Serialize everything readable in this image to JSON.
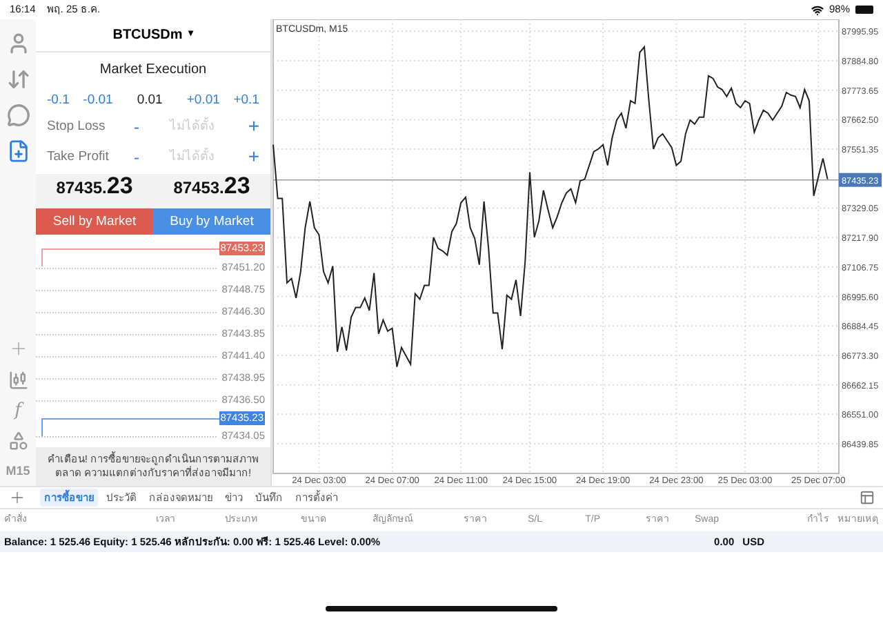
{
  "status_bar": {
    "time": "16:14",
    "date": "พฤ. 25 ธ.ค.",
    "battery": "98%"
  },
  "toolbar": {
    "tools": [
      {
        "selected": false
      },
      {
        "selected": false
      },
      {
        "selected": false
      },
      {
        "selected": true
      }
    ],
    "indicator_glyph": "f",
    "timeframe": "M15"
  },
  "order_panel": {
    "symbol": "BTCUSDm",
    "symbol_caret": "▾",
    "execution": "Market Execution",
    "volume_steps": [
      {
        "label": "-0.1"
      },
      {
        "label": "-0.01"
      },
      {
        "label": "+0.01"
      },
      {
        "label": "+0.1"
      }
    ],
    "volume": "0.01",
    "fields": [
      {
        "label": "Stop Loss",
        "placeholder": "ไม่ได้ตั้ง",
        "minus": "-",
        "plus": "+"
      },
      {
        "label": "Take Profit",
        "placeholder": "ไม่ได้ตั้ง",
        "minus": "-",
        "plus": "+"
      }
    ],
    "bid": {
      "head": "87435.",
      "tail": "23"
    },
    "ask": {
      "head": "87453.",
      "tail": "23"
    },
    "sell_button": "Sell by Market",
    "buy_button": "Buy by Market",
    "depth": [
      {
        "kind": "ask",
        "price": "87453.23"
      },
      {
        "kind": "level",
        "price": "87451.20"
      },
      {
        "kind": "level",
        "price": "87448.75"
      },
      {
        "kind": "level",
        "price": "87446.30"
      },
      {
        "kind": "level",
        "price": "87443.85"
      },
      {
        "kind": "level",
        "price": "87441.40"
      },
      {
        "kind": "level",
        "price": "87438.95"
      },
      {
        "kind": "level",
        "price": "87436.50"
      },
      {
        "kind": "bid",
        "price": "87435.23"
      },
      {
        "kind": "level",
        "price": "87434.05"
      }
    ],
    "warning": "คำเตือน! การซื้อขายจะถูกดำเนินการตามสภาพตลาด ความแตกต่างกับราคาที่ส่งอาจมีมาก!"
  },
  "chart": {
    "title": "BTCUSDm, M15",
    "chart_data": {
      "type": "line",
      "grid": true,
      "ylim": [
        86328,
        88041
      ],
      "ref_lines": [
        {
          "axis": "y",
          "value": 87435.23,
          "label": "87435.23"
        }
      ],
      "yticks": [
        {
          "value": 87995.95,
          "label": "87995.95"
        },
        {
          "value": 87884.8,
          "label": "87884.80"
        },
        {
          "value": 87773.65,
          "label": "87773.65"
        },
        {
          "value": 87662.5,
          "label": "87662.50"
        },
        {
          "value": 87551.35,
          "label": "87551.35"
        },
        {
          "value": 87329.05,
          "label": "87329.05"
        },
        {
          "value": 87217.9,
          "label": "87217.90"
        },
        {
          "value": 87106.75,
          "label": "87106.75"
        },
        {
          "value": 86995.6,
          "label": "86995.60"
        },
        {
          "value": 86884.45,
          "label": "86884.45"
        },
        {
          "value": 86773.3,
          "label": "86773.30"
        },
        {
          "value": 86662.15,
          "label": "86662.15"
        },
        {
          "value": 86551,
          "label": "86551.00"
        },
        {
          "value": 86439.85,
          "label": "86439.85"
        }
      ],
      "categories": [
        null,
        null,
        null,
        null,
        null,
        null,
        null,
        null,
        null,
        null,
        "24 Dec 03:00",
        null,
        null,
        null,
        null,
        null,
        null,
        null,
        null,
        null,
        null,
        null,
        null,
        null,
        null,
        null,
        "24 Dec 07:00",
        null,
        null,
        null,
        null,
        null,
        null,
        null,
        null,
        null,
        null,
        null,
        null,
        null,
        null,
        "24 Dec 11:00",
        null,
        null,
        null,
        null,
        null,
        null,
        null,
        null,
        null,
        null,
        null,
        null,
        null,
        null,
        "24 Dec 15:00",
        null,
        null,
        null,
        null,
        null,
        null,
        null,
        null,
        null,
        null,
        null,
        null,
        null,
        null,
        null,
        "24 Dec 19:00",
        null,
        null,
        null,
        null,
        null,
        null,
        null,
        null,
        null,
        null,
        null,
        null,
        null,
        null,
        null,
        "24 Dec 23:00",
        null,
        null,
        null,
        null,
        null,
        null,
        null,
        null,
        null,
        null,
        null,
        null,
        null,
        null,
        "25 Dec 03:00",
        null,
        null,
        null,
        null,
        null,
        null,
        null,
        null,
        null,
        null,
        null,
        null,
        null,
        null,
        null,
        "25 Dec 07:00",
        null,
        null
      ],
      "series": [
        {
          "color": "#222222",
          "values": [
            87568,
            87365,
            87365,
            87047,
            87063,
            86990,
            87089,
            87255,
            87354,
            87255,
            87229,
            87089,
            87047,
            87110,
            86787,
            86881,
            86792,
            86917,
            86954,
            86954,
            86990,
            86943,
            87084,
            86855,
            86907,
            86865,
            86876,
            86730,
            86803,
            86771,
            86740,
            87006,
            86985,
            87037,
            87037,
            87219,
            87177,
            87167,
            87151,
            87240,
            87271,
            87349,
            87370,
            87255,
            87214,
            87115,
            87354,
            87177,
            86933,
            86933,
            86797,
            87000,
            86985,
            87058,
            86922,
            87125,
            87464,
            87219,
            87281,
            87396,
            87323,
            87255,
            87297,
            87349,
            87386,
            87401,
            87349,
            87432,
            87438,
            87490,
            87542,
            87552,
            87568,
            87490,
            87594,
            87661,
            87687,
            87630,
            87734,
            87724,
            87916,
            87937,
            87734,
            87552,
            87594,
            87609,
            87583,
            87557,
            87490,
            87505,
            87609,
            87661,
            87646,
            87672,
            87672,
            87828,
            87818,
            87786,
            87776,
            87750,
            87781,
            87724,
            87708,
            87734,
            87724,
            87615,
            87661,
            87698,
            87687,
            87661,
            87687,
            87713,
            87765,
            87755,
            87750,
            87708,
            87776,
            87734,
            87375,
            87448,
            87516,
            87438
          ]
        }
      ]
    }
  },
  "bottom_tabs": [
    {
      "label": "การซื้อขาย",
      "selected": true
    },
    {
      "label": "ประวัติ",
      "selected": false
    },
    {
      "label": "กล่องจดหมาย",
      "selected": false
    },
    {
      "label": "ข่าว",
      "selected": false
    },
    {
      "label": "บันทึก",
      "selected": false
    },
    {
      "label": "การตั้งค่า",
      "selected": false
    }
  ],
  "table": {
    "columns": [
      "คำสั่ง",
      "เวลา",
      "ประเภท",
      "ขนาด",
      "สัญลักษณ์",
      "ราคา",
      "S/L",
      "T/P",
      "ราคา",
      "Swap",
      "กำไร",
      "หมายเหตุ"
    ],
    "summary": "Balance: 1 525.46 Equity: 1 525.46 หลักประกัน: 0.00 ฟรี: 1 525.46 Level: 0.00%",
    "profit": "0.00",
    "currency": "USD"
  }
}
